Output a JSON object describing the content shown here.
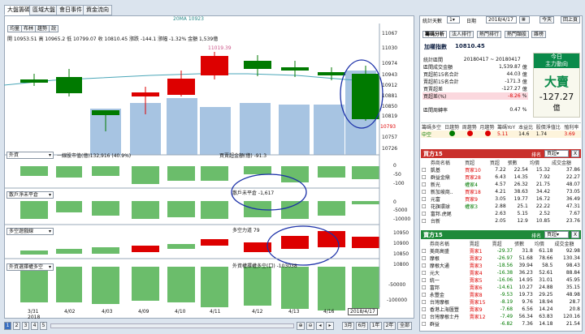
{
  "tabs": [
    "大盤籌碼",
    "區域大盤",
    "會日事件",
    "資金流向"
  ],
  "legend": "20MA 10923",
  "chart_tools": [
    "均量",
    "布林",
    "趨勢",
    "說"
  ],
  "ohlc": "開 10953.51 高 10965.2 低 10799.07 收 10810.45 漲跌 -144.1 漲幅 -1.32% 金額 1,539億",
  "price_axis": [
    "11067",
    "11030",
    "10974",
    "10943",
    "10912",
    "10881",
    "10850",
    "10819",
    "10793",
    "10757",
    "10726"
  ],
  "price_ann": "11019.39",
  "panel1": {
    "select": "外資",
    "legend": "一線股市值(億)132,916 (40.9%)",
    "legend2": "買賣超金額(億) -91.3",
    "axis": [
      "0",
      "-50",
      "-100"
    ]
  },
  "panel2": {
    "select": "散戶淨未平倉",
    "legend": "散戶未平倉 -1,617",
    "axis": [
      "0",
      "-5000",
      "-10000"
    ]
  },
  "panel3": {
    "select": "多空遊戲線",
    "legend": "多空力道 79",
    "axis": [
      "10950",
      "10900",
      "10850",
      "10800"
    ]
  },
  "panel4": {
    "select": "外資選擇權多空",
    "legend": "外資權擇權多空(口) -103038",
    "axis": [
      "-50000",
      "-100000"
    ]
  },
  "dates": [
    "3/31",
    "4/02",
    "4/03",
    "4/09",
    "4/10",
    "4/11",
    "4/12",
    "4/13",
    "4/16",
    "2018/4/17"
  ],
  "year": "2018",
  "pages": [
    "1",
    "2",
    "3",
    "4",
    "5"
  ],
  "ranges": [
    "3月",
    "6月",
    "1年",
    "2年",
    "全部"
  ],
  "right": {
    "days_label": "統計天數",
    "days": "1",
    "date_label": "日期",
    "date": "2018/4/17",
    "today": "今天",
    "back": "回上頁",
    "subtabs": [
      "籌碼分析",
      "法人排行",
      "熱門排行",
      "熱門類股",
      "雜榜"
    ],
    "index_name": "加權指數",
    "index_val": "10810.45",
    "stats": [
      [
        "統計區間",
        "20180417 ~ 20180417",
        ""
      ],
      [
        "區間成交金額",
        "1,539.87",
        "億"
      ],
      [
        "買超前15名合計",
        "44.03",
        "億"
      ],
      [
        "賣超前15名合計",
        "-171.3",
        "億"
      ],
      [
        "買賣超差",
        "-127.27",
        "億"
      ],
      [
        "買超差(%)",
        "-8.26",
        "%"
      ],
      [
        "區間周轉率",
        "0.47",
        "%"
      ]
    ],
    "today_title": "今日",
    "main_force": "主力動向",
    "verdict": "大賣",
    "verdict_val": "-127.27",
    "verdict_unit": "億",
    "ind_headers": [
      "籌碼多空",
      "日趨勢",
      "周趨勢",
      "月趨勢",
      "籌碼YoY",
      "本益比",
      "股價淨值比",
      "殖利率"
    ],
    "ind_row": [
      "中空",
      "",
      "",
      "",
      "5.11",
      "14.6",
      "1.74",
      "3.69"
    ],
    "buy_title": "買方15",
    "sell_title": "賣方15",
    "rank": "排名",
    "buy_sel": "買超",
    "close": "X",
    "buy_head": [
      "券商名稱",
      "買超",
      "買超",
      "張數",
      "均價",
      "成交金額"
    ],
    "buy_rows": [
      [
        "凱基",
        "買家10",
        "7.22",
        "22.54",
        "15.32",
        "37.86"
      ],
      [
        "群益金鼎",
        "買家28",
        "6.43",
        "14.35",
        "7.92",
        "22.27"
      ],
      [
        "新光",
        "權家4",
        "4.57",
        "26.32",
        "21.75",
        "48.07"
      ],
      [
        "新加坡商..",
        "買家18",
        "4.21",
        "38.63",
        "34.42",
        "73.05"
      ],
      [
        "元富",
        "買家9",
        "3.05",
        "19.77",
        "16.72",
        "36.49"
      ],
      [
        "花旗環球",
        "權家3",
        "2.88",
        "25.1",
        "22.22",
        "47.31"
      ],
      [
        "富邦.虎尾",
        "",
        "2.63",
        "5.15",
        "2.52",
        "7.67"
      ],
      [
        "台新",
        "",
        "2.05",
        "12.9",
        "10.85",
        "23.76"
      ]
    ],
    "sell_head": [
      "券商名稱",
      "賣超",
      "賣超",
      "張數",
      "均價",
      "成交金額"
    ],
    "sell_rows": [
      [
        "美商高盛",
        "賣家1",
        "-29.37",
        "31.8",
        "61.18",
        "92.98"
      ],
      [
        "摩根",
        "賣家2",
        "-26.97",
        "51.68",
        "78.66",
        "130.34"
      ],
      [
        "摩根大通",
        "賣家3",
        "-18.56",
        "39.94",
        "58.5",
        "98.43"
      ],
      [
        "元大",
        "賣家4",
        "-16.38",
        "36.23",
        "52.61",
        "88.84"
      ],
      [
        "統一",
        "賣家5",
        "-16.06",
        "14.95",
        "31.01",
        "45.95"
      ],
      [
        "富邦",
        "賣家6",
        "-14.61",
        "10.27",
        "24.88",
        "35.15"
      ],
      [
        "永豐金",
        "賣家8",
        "-9.53",
        "19.73",
        "29.25",
        "48.98"
      ],
      [
        "台灣摩根",
        "賣家15",
        "-8.19",
        "9.76",
        "18.94",
        "28.7"
      ],
      [
        "香港上海匯豐",
        "賣家9",
        "-7.68",
        "6.56",
        "14.24",
        "20.8"
      ],
      [
        "台灣摩根士丹",
        "賣家12",
        "-7.49",
        "56.34",
        "63.83",
        "120.16"
      ],
      [
        "群益",
        "",
        "-6.82",
        "7.36",
        "14.18",
        "21.54"
      ]
    ]
  }
}
